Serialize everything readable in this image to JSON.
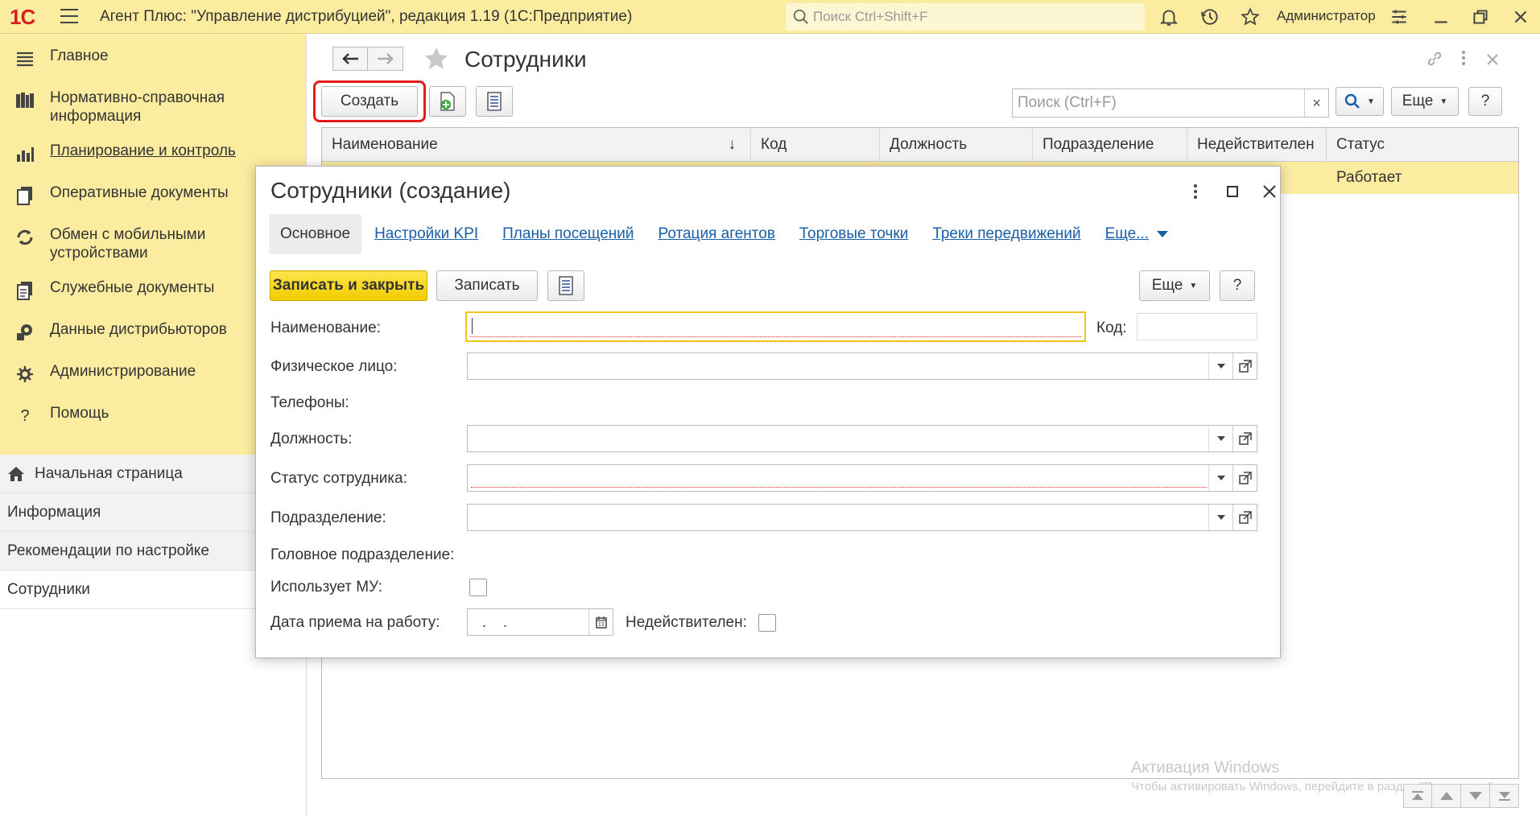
{
  "app": {
    "logo": "1С",
    "title": "Агент Плюс: \"Управление дистрибуцией\", редакция 1.19  (1С:Предприятие)",
    "search_placeholder": "Поиск Ctrl+Shift+F",
    "user": "Администратор"
  },
  "sidebar": {
    "sections": [
      {
        "label": "Главное",
        "icon": "menu-lines-icon"
      },
      {
        "label": "Нормативно-справочная информация",
        "icon": "reference-books-icon"
      },
      {
        "label": "Планирование и контроль",
        "icon": "bar-chart-icon"
      },
      {
        "label": "Оперативные документы",
        "icon": "documents-icon"
      },
      {
        "label": "Обмен с мобильными устройствами",
        "icon": "sync-icon"
      },
      {
        "label": "Служебные документы",
        "icon": "service-docs-icon"
      },
      {
        "label": "Данные дистрибьюторов",
        "icon": "distributor-data-icon"
      },
      {
        "label": "Администрирование",
        "icon": "gear-icon"
      },
      {
        "label": "Помощь",
        "icon": "question-icon"
      }
    ],
    "open_windows": [
      {
        "label": "Начальная страница"
      },
      {
        "label": "Информация"
      },
      {
        "label": "Рекомендации по настройке"
      },
      {
        "label": "Сотрудники"
      }
    ]
  },
  "list": {
    "title": "Сотрудники",
    "create_label": "Создать",
    "search_placeholder": "Поиск (Ctrl+F)",
    "more_label": "Еще",
    "help_label": "?",
    "columns": [
      "Наименование",
      "Код",
      "Должность",
      "Подразделение",
      "Недействителен",
      "Статус"
    ],
    "sort_indicator": "↓",
    "rows": [
      {
        "status": "Работает"
      }
    ]
  },
  "dialog": {
    "title": "Сотрудники (создание)",
    "tabs": [
      "Основное",
      "Настройки KPI",
      "Планы посещений",
      "Ротация агентов",
      "Торговые точки",
      "Треки передвижений",
      "Еще..."
    ],
    "save_close_label": "Записать и закрыть",
    "save_label": "Записать",
    "more_label": "Еще",
    "help_label": "?",
    "fields": {
      "name_label": "Наименование:",
      "code_label": "Код:",
      "person_label": "Физическое лицо:",
      "phones_label": "Телефоны:",
      "position_label": "Должность:",
      "status_label": "Статус сотрудника:",
      "department_label": "Подразделение:",
      "head_department_label": "Головное подразделение:",
      "uses_mu_label": "Использует МУ:",
      "hire_date_label": "Дата приема на работу:",
      "hire_date_value": ". .",
      "invalid_label": "Недействителен:"
    }
  },
  "watermark": {
    "line1": "Активация Windows",
    "line2": "Чтобы активировать Windows, перейдите в раздел \"Параметры\"."
  }
}
